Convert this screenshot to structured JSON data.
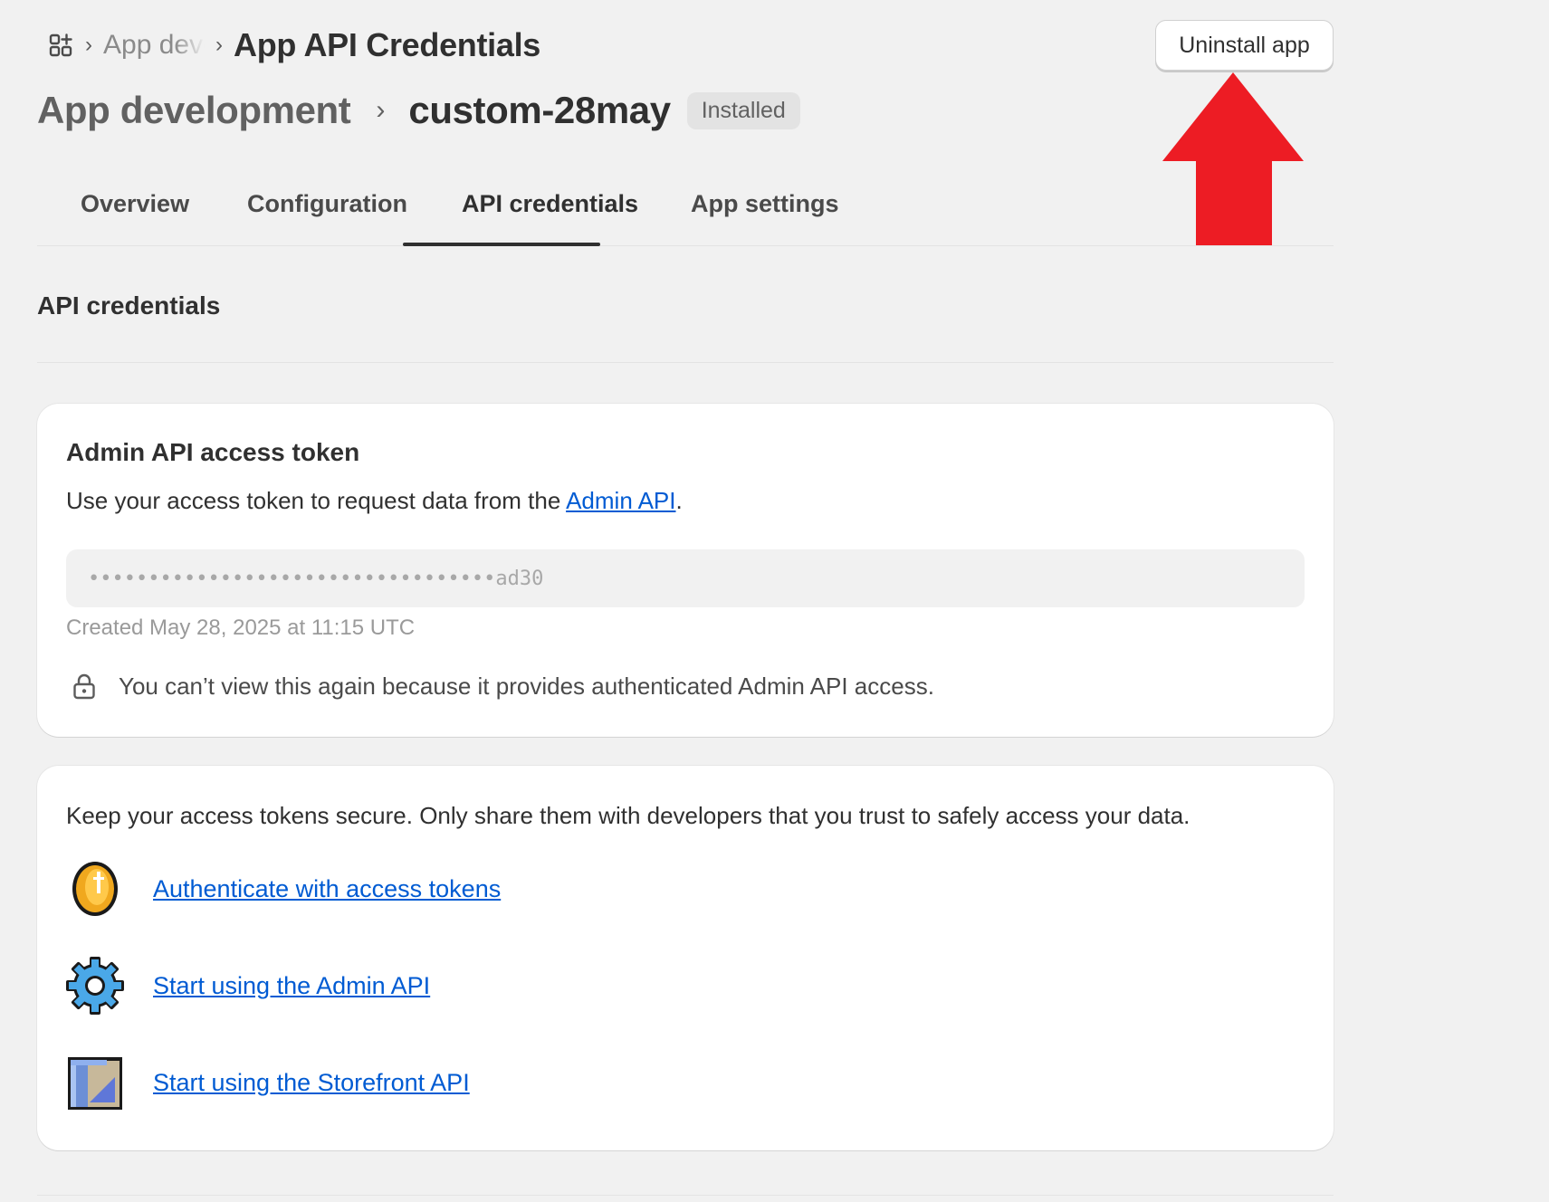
{
  "breadcrumb": {
    "parent": "App development",
    "current": "App API Credentials"
  },
  "header": {
    "uninstall_label": "Uninstall app",
    "title_parent": "App development",
    "app_name": "custom-28may",
    "status_badge": "Installed"
  },
  "tabs": [
    {
      "label": "Overview"
    },
    {
      "label": "Configuration"
    },
    {
      "label": "API credentials"
    },
    {
      "label": "App settings"
    }
  ],
  "active_tab": "API credentials",
  "section_title": "API credentials",
  "token_card": {
    "title": "Admin API access token",
    "desc_prefix": "Use your access token to request data from the ",
    "desc_link": "Admin API",
    "desc_suffix": ".",
    "token_masked": "••••••••••••••••••••••••••••••••••ad30",
    "created": "Created May 28, 2025 at 11:15 UTC",
    "warning": "You can’t view this again because it provides authenticated Admin API access."
  },
  "resources_card": {
    "text": "Keep your access tokens secure. Only share them with developers that you trust to safely access your data.",
    "links": [
      {
        "label": "Authenticate with access tokens",
        "icon": "coin-icon"
      },
      {
        "label": "Start using the Admin API",
        "icon": "gear-icon"
      },
      {
        "label": "Start using the Storefront API",
        "icon": "blueprint-icon"
      }
    ]
  },
  "colors": {
    "link": "#005bd3",
    "annotation_arrow": "#ed1c24",
    "background": "#f1f1f1"
  }
}
